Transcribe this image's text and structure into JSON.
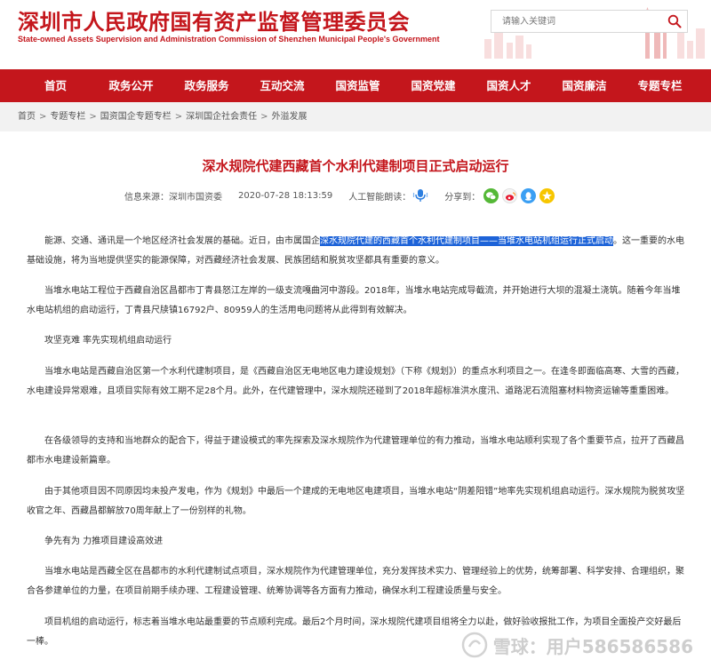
{
  "header": {
    "title": "深圳市人民政府国有资产监督管理委员会",
    "subtitle": "State-owned Assets Supervision and Administration Commission of Shenzhen Municipal People's Government",
    "search": {
      "placeholder": "请输入关键词",
      "icon": "search-icon"
    },
    "colors": {
      "brand_red": "#c4161c"
    }
  },
  "nav": {
    "items": [
      {
        "label": "首页"
      },
      {
        "label": "政务公开"
      },
      {
        "label": "政务服务"
      },
      {
        "label": "互动交流"
      },
      {
        "label": "国资监管"
      },
      {
        "label": "国资党建"
      },
      {
        "label": "国资人才"
      },
      {
        "label": "国资廉洁"
      },
      {
        "label": "专题专栏"
      }
    ]
  },
  "breadcrumb": [
    "首页",
    "专题专栏",
    "国资国企专题专栏",
    "深圳国企社会责任",
    "外溢发展"
  ],
  "article": {
    "title": "深水规院代建西藏首个水利代建制项目正式启动运行",
    "meta": {
      "source_label": "信息来源：",
      "source": "深圳市国资委",
      "date": "2020-07-28 18:13:59",
      "reader_label": "人工智能朗读：",
      "share_label": "分享到："
    },
    "share_icons": [
      "wechat-icon",
      "weibo-icon",
      "qq-icon",
      "qzone-icon"
    ],
    "paragraphs": {
      "p1_before": "能源、交通、通讯是一个地区经济社会发展的基础。近日，由市属国企",
      "p1_highlight": "深水规院代建的西藏首个水利代建制项目——当堆水电站机组运行正式启动",
      "p1_after": "。这一重要的水电基础设施，将为当地提供坚实的能源保障，对西藏经济社会发展、民族团结和脱贫攻坚都具有重要的意义。",
      "p2": "当堆水电站工程位于西藏自治区昌都市丁青县怒江左岸的一级支流嘎曲河中游段。2018年，当堆水电站完成导截流，并开始进行大坝的混凝土浇筑。随着今年当堆水电站机组的启动运行，丁青县尺牍镇16792户、80959人的生活用电问题将从此得到有效解决。",
      "h1": "攻坚克难  率先实现机组启动运行",
      "p3": "当堆水电站是西藏自治区第一个水利代建制项目，是《西藏自治区无电地区电力建设规划》（下称《规划》）的重点水利项目之一。在逢冬即面临高寒、大雪的西藏，水电建设异常艰难，且项目实际有效工期不足28个月。此外，在代建管理中，深水规院还碰到了2018年超标准洪水度汛、道路泥石流阻塞材料物资运输等重重困难。",
      "p4": "在各级领导的支持和当地群众的配合下，得益于建设模式的率先探索及深水规院作为代建管理单位的有力推动，当堆水电站顺利实现了各个重要节点，拉开了西藏昌都市水电建设新篇章。",
      "p5": "由于其他项目因不同原因均未投产发电，作为《规划》中最后一个建成的无电地区电建项目，当堆水电站“阴差阳错”地率先实现机组启动运行。深水规院为脱贫攻坚收官之年、西藏昌都解放70周年献上了一份别样的礼物。",
      "h2": "争先有为  力推项目建设高效进",
      "p6": "当堆水电站是西藏全区在昌都市的水利代建制试点项目，深水规院作为代建管理单位，充分发挥技术实力、管理经验上的优势，统筹部署、科学安排、合理组织，聚合各参建单位的力量，在项目前期手续办理、工程建设管理、统筹协调等各方面有力推动，确保水利工程建设质量与安全。",
      "p7": "项目机组的启动运行，标志着当堆水电站最重要的节点顺利完成。最后2个月时间，深水规院代建项目组将全力以赴，做好验收报批工作，为项目全面投产交好最后一棒。"
    },
    "highlight_color": "#1d63d8"
  },
  "watermark": {
    "text": "雪球：用户586586586"
  }
}
